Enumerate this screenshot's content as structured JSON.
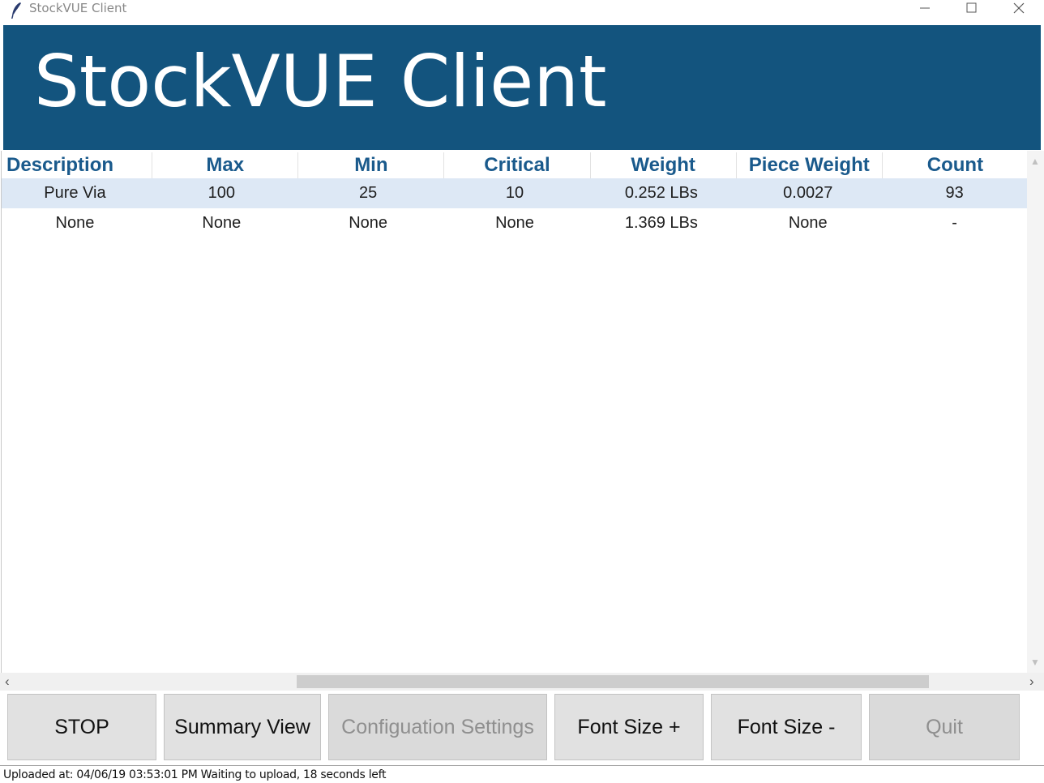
{
  "window": {
    "title": "StockVUE Client",
    "icon": "feather-icon",
    "controls": [
      "minimize-icon",
      "maximize-icon",
      "close-icon"
    ]
  },
  "banner": {
    "title": "StockVUE Client",
    "background": "#13547e"
  },
  "table": {
    "columns": [
      "Description",
      "Max",
      "Min",
      "Critical",
      "Weight",
      "Piece Weight",
      "Count"
    ],
    "rows": [
      [
        "Pure Via",
        "100",
        "25",
        "10",
        "0.252 LBs",
        "0.0027",
        "93"
      ],
      [
        "None",
        "None",
        "None",
        "None",
        "1.369 LBs",
        "None",
        "-"
      ]
    ],
    "selected_row": 0,
    "header_color": "#1a5a8c"
  },
  "buttons": {
    "stop": "STOP",
    "summary": "Summary View",
    "config": "Configuation Settings",
    "font_plus": "Font Size +",
    "font_minus": "Font Size -",
    "quit": "Quit"
  },
  "status": {
    "text": "Uploaded at: 04/06/19 03:53:01 PM Waiting to upload, 18 seconds left"
  }
}
